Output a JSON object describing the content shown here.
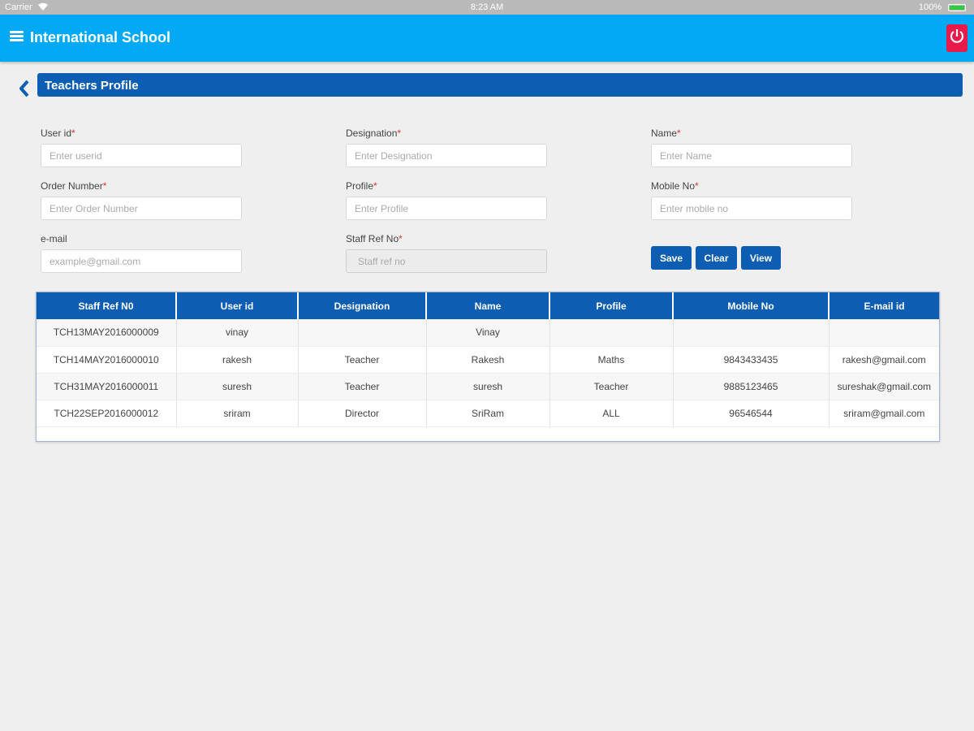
{
  "status_bar": {
    "carrier": "Carrier",
    "time": "8:23 AM",
    "battery": "100%",
    "wifi_icon": "wifi-icon",
    "battery_icon": "battery-icon"
  },
  "app_bar": {
    "title": "International School",
    "menu_icon": "menu-icon",
    "power_icon": "power-icon"
  },
  "page": {
    "title": "Teachers Profile",
    "back_icon": "chevron-left-icon"
  },
  "form": {
    "user_id": {
      "label": "User id",
      "placeholder": "Enter userid",
      "value": ""
    },
    "designation": {
      "label": "Designation",
      "placeholder": "Enter Designation",
      "value": ""
    },
    "name": {
      "label": "Name",
      "placeholder": "Enter Name",
      "value": ""
    },
    "order_number": {
      "label": "Order Number",
      "placeholder": "Enter Order Number",
      "value": ""
    },
    "profile": {
      "label": "Profile",
      "placeholder": "Enter Profile",
      "value": ""
    },
    "mobile_no": {
      "label": "Mobile No",
      "placeholder": "Enter mobile no",
      "value": ""
    },
    "email": {
      "label": "e-mail",
      "placeholder": "example@gmail.com",
      "value": ""
    },
    "staff_ref_no": {
      "label": "Staff Ref No",
      "placeholder": "Staff ref no",
      "value": ""
    },
    "required_mark": "*"
  },
  "buttons": {
    "save": "Save",
    "clear": "Clear",
    "view": "View"
  },
  "table": {
    "columns": [
      "Staff Ref N0",
      "User id",
      "Designation",
      "Name",
      "Profile",
      "Mobile No",
      "E-mail id"
    ],
    "rows": [
      [
        "TCH13MAY2016000009",
        "vinay",
        "",
        "Vinay",
        "",
        "",
        ""
      ],
      [
        "TCH14MAY2016000010",
        "rakesh",
        "Teacher",
        "Rakesh",
        "Maths",
        "9843433435",
        "rakesh@gmail.com"
      ],
      [
        "TCH31MAY2016000011",
        "suresh",
        "Teacher",
        "suresh",
        "Teacher",
        "9885123465",
        "sureshak@gmail.com"
      ],
      [
        "TCH22SEP2016000012",
        "sriram",
        "Director",
        "SriRam",
        "ALL",
        "96546544",
        "sriram@gmail.com"
      ]
    ]
  },
  "colors": {
    "app_bar": "#03a9f4",
    "primary": "#0d5eb2",
    "power_button": "#e8194b",
    "background": "#efefef"
  }
}
